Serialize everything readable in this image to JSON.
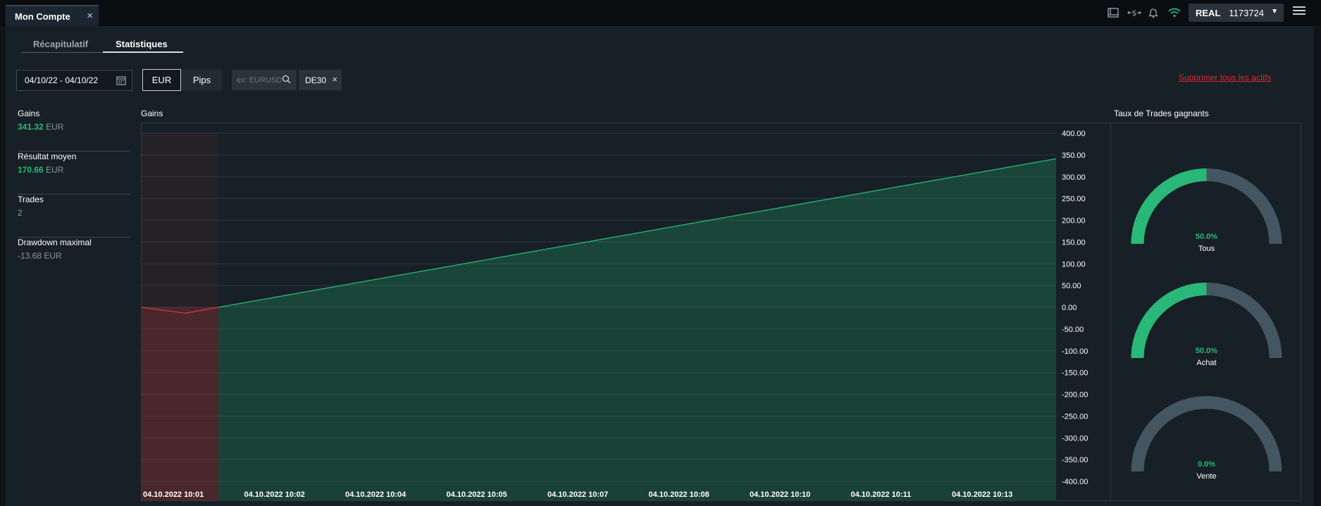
{
  "window": {
    "tab_title": "Mon Compte",
    "tab_close": "×"
  },
  "topbar": {
    "icons": [
      "layout-icon",
      "transfer-dollar-icon",
      "bell-icon",
      "wifi-icon"
    ],
    "account_mode": "REAL",
    "account_number": "1173724",
    "account_caret": "▼"
  },
  "subtabs": [
    {
      "label": "Récapitulatif"
    },
    {
      "label": "Statistiques"
    }
  ],
  "filters": {
    "date_range": "04/10/22 - 04/10/22",
    "units": [
      "EUR",
      "Pips"
    ],
    "search_placeholder": "ex: EURUSD",
    "chip": "DE30",
    "chip_close": "×",
    "delete_all": "Supprimer tous les actifs"
  },
  "stats": [
    {
      "label": "Gains",
      "value": "341.32",
      "unit": "EUR",
      "tone": "green"
    },
    {
      "label": "Résultat moyen",
      "value": "170.66",
      "unit": "EUR",
      "tone": "green"
    },
    {
      "label": "Trades",
      "value": "2",
      "unit": "",
      "tone": "grey"
    },
    {
      "label": "Drawdown maximal",
      "value": "-13.68",
      "unit": "EUR",
      "tone": "grey"
    }
  ],
  "colors": {
    "positive": "#29b877",
    "negative": "#d23a3a",
    "gauge_track": "#435661",
    "link": "#e0282e"
  },
  "chart_title": "Gains",
  "chart_data": {
    "type": "area",
    "title": "Gains",
    "x_ticks": [
      "04.10.2022 10:01",
      "04.10.2022 10:02",
      "04.10.2022 10:04",
      "04.10.2022 10:05",
      "04.10.2022 10:07",
      "04.10.2022 10:08",
      "04.10.2022 10:10",
      "04.10.2022 10:11",
      "04.10.2022 10:13"
    ],
    "y_ticks": [
      400,
      350,
      300,
      250,
      200,
      150,
      100,
      50,
      0,
      -50,
      -100,
      -150,
      -200,
      -250,
      -300,
      -350,
      -400
    ],
    "y_tick_labels": [
      "400.00",
      "350.00",
      "300.00",
      "250.00",
      "200.00",
      "150.00",
      "100.00",
      "50.00",
      "0.00",
      "-50.00",
      "-100.00",
      "-150.00",
      "-200.00",
      "-250.00",
      "-300.00",
      "-350.00",
      "-400.00"
    ],
    "ylim": [
      -400,
      400
    ],
    "y_axis_position": "right",
    "grid": true,
    "series": [
      {
        "points": [
          {
            "x": "04.10.2022 10:01",
            "y": 0
          },
          {
            "x": "04.10.2022 10:01",
            "y": -13.68
          },
          {
            "x": "04.10.2022 10:02",
            "y": 0
          },
          {
            "x": "04.10.2022 10:14",
            "y": 341.32
          }
        ]
      }
    ]
  },
  "gauges_title": "Taux de Trades gagnants",
  "gauges": [
    {
      "label": "Tous",
      "percent_text": "50.0%",
      "value": 50
    },
    {
      "label": "Achat",
      "percent_text": "50.0%",
      "value": 50
    },
    {
      "label": "Vente",
      "percent_text": "0.0%",
      "value": 0
    }
  ]
}
